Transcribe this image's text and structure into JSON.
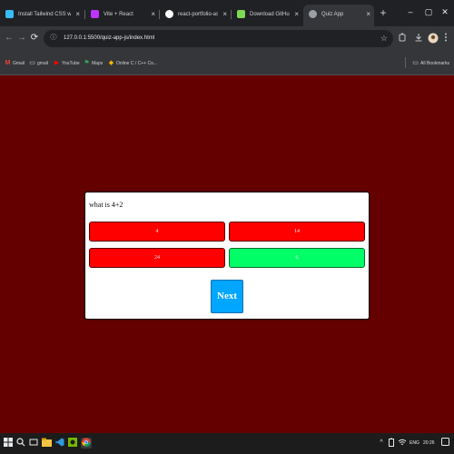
{
  "tabs": [
    {
      "title": "Install Tailwind CSS with",
      "favicon_color": "#38bdf8"
    },
    {
      "title": "Vite + React",
      "favicon_color": "#bd34fe"
    },
    {
      "title": "react-portfolio-assets-l",
      "favicon_color": "#ffffff"
    },
    {
      "title": "Download GitHub client",
      "favicon_color": "#7ed957"
    },
    {
      "title": "Quiz App",
      "favicon_color": "#9aa0a6",
      "active": true
    }
  ],
  "tab_close_glyph": "×",
  "new_tab_glyph": "+",
  "window_controls": {
    "minimize": "–",
    "maximize": "▢",
    "close": "✕"
  },
  "nav": {
    "back": "←",
    "forward": "→",
    "reload": "⟳"
  },
  "omnibox": {
    "url": "127.0.0.1:5500/quiz-app-js/index.html",
    "site_info_glyph": "ⓘ",
    "star_glyph": "☆"
  },
  "toolbar_icons": [
    "extensions-icon",
    "download-icon",
    "profile-icon",
    "menu-icon"
  ],
  "bookmarks": [
    {
      "label": "Gmail",
      "icon": "gmail-icon",
      "color": "#ea4335",
      "glyph": "M"
    },
    {
      "label": "gmail",
      "icon": "folder-icon",
      "color": "#cfd2d6",
      "glyph": "▭"
    },
    {
      "label": "YouTube",
      "icon": "youtube-icon",
      "color": "#ff0000",
      "glyph": "▶"
    },
    {
      "label": "Maps",
      "icon": "maps-icon",
      "color": "#34a853",
      "glyph": "⚑"
    },
    {
      "label": "Online C / C++ Co...",
      "icon": "code-icon",
      "color": "#f4b400",
      "glyph": "◆"
    }
  ],
  "all_bookmarks": "All Bookmarks",
  "quiz": {
    "question": "what is 4+2",
    "answers": [
      {
        "text": "4",
        "state": "wrong"
      },
      {
        "text": "14",
        "state": "wrong"
      },
      {
        "text": "24",
        "state": "wrong"
      },
      {
        "text": "6",
        "state": "correct"
      }
    ],
    "next_label": "Next"
  },
  "colors": {
    "page_background": "#650000",
    "wrong_answer": "#ff0000",
    "correct_answer": "#00ff66",
    "next_button": "#00a6ff"
  },
  "taskbar": {
    "language": "ENG",
    "time": "20:26"
  }
}
